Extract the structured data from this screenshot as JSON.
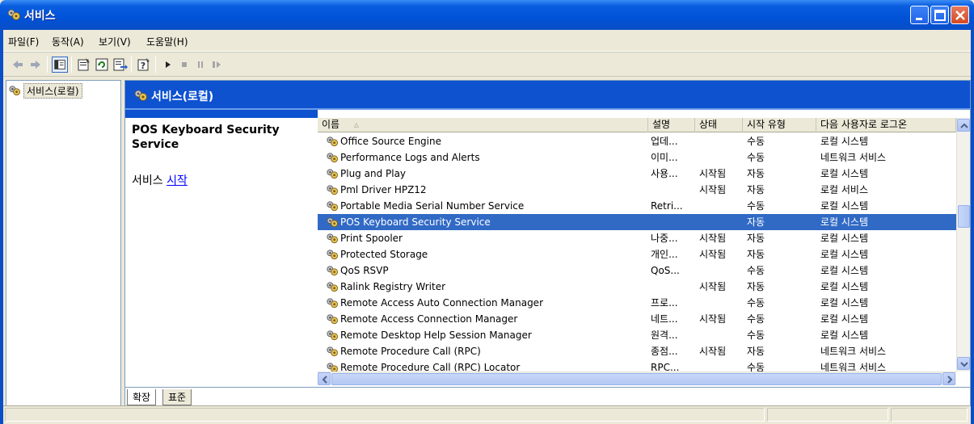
{
  "window": {
    "title": "서비스"
  },
  "menu": {
    "items": [
      "파일(F)",
      "동작(A)",
      "보기(V)",
      "도움말(H)"
    ]
  },
  "toolbar": {
    "buttons": [
      "back-arrow-icon",
      "forward-arrow-icon",
      "show-hide-tree-icon",
      "properties-icon",
      "refresh-icon",
      "export-list-icon",
      "help-icon",
      "start-service-icon",
      "stop-service-icon",
      "pause-service-icon",
      "restart-service-icon"
    ]
  },
  "tree": {
    "root": "서비스(로컬)"
  },
  "banner": {
    "title": "서비스(로컬)"
  },
  "description": {
    "service_name": "POS Keyboard Security Service",
    "action_prefix": "서비스 ",
    "action_link": "시작"
  },
  "list": {
    "columns": [
      "이름",
      "설명",
      "상태",
      "시작 유형",
      "다음 사용자로 로그온"
    ],
    "rows": [
      {
        "name": "Office Source Engine",
        "desc": "업데...",
        "status": "",
        "startup": "수동",
        "logon": "로컬 시스템"
      },
      {
        "name": "Performance Logs and Alerts",
        "desc": "이미...",
        "status": "",
        "startup": "수동",
        "logon": "네트워크 서비스"
      },
      {
        "name": "Plug and Play",
        "desc": "사용...",
        "status": "시작됨",
        "startup": "자동",
        "logon": "로컬 시스템"
      },
      {
        "name": "Pml Driver HPZ12",
        "desc": "",
        "status": "시작됨",
        "startup": "자동",
        "logon": "로컬 서비스"
      },
      {
        "name": "Portable Media Serial Number Service",
        "desc": "Retri...",
        "status": "",
        "startup": "수동",
        "logon": "로컬 시스템"
      },
      {
        "name": "POS Keyboard Security Service",
        "desc": "",
        "status": "",
        "startup": "자동",
        "logon": "로컬 시스템",
        "selected": true
      },
      {
        "name": "Print Spooler",
        "desc": "나중...",
        "status": "시작됨",
        "startup": "자동",
        "logon": "로컬 시스템"
      },
      {
        "name": "Protected Storage",
        "desc": "개인...",
        "status": "시작됨",
        "startup": "자동",
        "logon": "로컬 시스템"
      },
      {
        "name": "QoS RSVP",
        "desc": "QoS...",
        "status": "",
        "startup": "수동",
        "logon": "로컬 시스템"
      },
      {
        "name": "Ralink Registry Writer",
        "desc": "",
        "status": "시작됨",
        "startup": "자동",
        "logon": "로컬 시스템"
      },
      {
        "name": "Remote Access Auto Connection Manager",
        "desc": "프로...",
        "status": "",
        "startup": "수동",
        "logon": "로컬 시스템"
      },
      {
        "name": "Remote Access Connection Manager",
        "desc": "네트...",
        "status": "시작됨",
        "startup": "수동",
        "logon": "로컬 시스템"
      },
      {
        "name": "Remote Desktop Help Session Manager",
        "desc": "원격...",
        "status": "",
        "startup": "수동",
        "logon": "로컬 시스템"
      },
      {
        "name": "Remote Procedure Call (RPC)",
        "desc": "종점...",
        "status": "시작됨",
        "startup": "자동",
        "logon": "네트워크 서비스"
      },
      {
        "name": "Remote Procedure Call (RPC) Locator",
        "desc": "RPC...",
        "status": "",
        "startup": "수동",
        "logon": "네트워크 서비스"
      }
    ]
  },
  "tabs": [
    "확장",
    "표준"
  ],
  "colors": {
    "title_blue": "#0052d6",
    "banner_blue": "#0e52d0",
    "selection": "#316ac5",
    "link": "#0000ff"
  }
}
